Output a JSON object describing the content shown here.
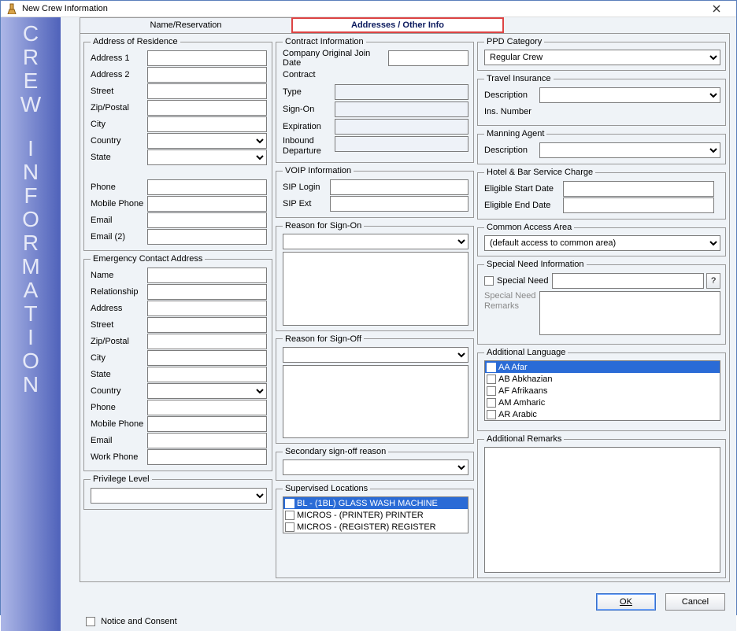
{
  "window": {
    "title": "New Crew Information"
  },
  "tabs": {
    "name_res": "Name/Reservation",
    "addresses": "Addresses / Other Info"
  },
  "sidebar": "CREW INFORMATION",
  "residence": {
    "legend": "Address of Residence",
    "address1": "Address 1",
    "address1_v": "",
    "address2": "Address 2",
    "address2_v": "",
    "street": "Street",
    "street_v": "",
    "zip": "Zip/Postal",
    "zip_v": "",
    "city": "City",
    "city_v": "",
    "country": "Country",
    "country_v": "",
    "state": "State",
    "state_v": "",
    "phone": "Phone",
    "phone_v": "",
    "mobile": "Mobile Phone",
    "mobile_v": "",
    "email": "Email",
    "email_v": "",
    "email2": "Email (2)",
    "email2_v": ""
  },
  "emergency": {
    "legend": "Emergency Contact Address",
    "name": "Name",
    "name_v": "",
    "relationship": "Relationship",
    "relationship_v": "",
    "address": "Address",
    "address_v": "",
    "street": "Street",
    "street_v": "",
    "zip": "Zip/Postal",
    "zip_v": "",
    "city": "City",
    "city_v": "",
    "state": "State",
    "state_v": "",
    "country": "Country",
    "country_v": "",
    "phone": "Phone",
    "phone_v": "",
    "mobile": "Mobile Phone",
    "mobile_v": "",
    "email": "Email",
    "email_v": "",
    "workphone": "Work Phone",
    "workphone_v": ""
  },
  "privilege": {
    "legend": "Privilege Level",
    "value": ""
  },
  "contract": {
    "legend": "Contract Information",
    "cojd": "Company Original Join Date",
    "cojd_v": "",
    "contract": "Contract",
    "type": "Type",
    "type_v": "",
    "signon": "Sign-On",
    "signon_v": "",
    "expiration": "Expiration",
    "expiration_v": "",
    "inbound": "Inbound Departure",
    "inbound_v": ""
  },
  "voip": {
    "legend": "VOIP Information",
    "login": "SIP Login",
    "login_v": "",
    "ext": "SIP Ext",
    "ext_v": ""
  },
  "signon_reason": {
    "legend": "Reason for Sign-On",
    "value": "",
    "text": ""
  },
  "signoff_reason": {
    "legend": "Reason for Sign-Off",
    "value": "",
    "text": ""
  },
  "signoff2": {
    "legend": "Secondary sign-off reason",
    "value": ""
  },
  "supervised": {
    "legend": "Supervised Locations",
    "items": [
      "BL - (1BL) GLASS WASH MACHINE",
      "MICROS - (PRINTER) PRINTER",
      "MICROS - (REGISTER) REGISTER"
    ]
  },
  "ppd": {
    "legend": "PPD  Category",
    "value": "Regular Crew"
  },
  "travel": {
    "legend": "Travel Insurance",
    "desc": "Description",
    "desc_v": "",
    "num": "Ins. Number",
    "num_v": ""
  },
  "manning": {
    "legend": "Manning Agent",
    "desc": "Description",
    "desc_v": ""
  },
  "hotel": {
    "legend": "Hotel & Bar Service Charge",
    "start": "Eligible Start Date",
    "start_v": "",
    "end": "Eligible End Date",
    "end_v": ""
  },
  "common": {
    "legend": "Common Access Area",
    "value": "(default access to common area)"
  },
  "special": {
    "legend": "Special Need Information",
    "cb": "Special Need",
    "qmark": "?",
    "remarks": "Special Need Remarks",
    "remarks_v": ""
  },
  "lang": {
    "legend": "Additional Language",
    "items": [
      "AA Afar",
      "AB Abkhazian",
      "AF Afrikaans",
      "AM Amharic",
      "AR Arabic"
    ]
  },
  "remarks": {
    "legend": "Additional Remarks",
    "text": ""
  },
  "buttons": {
    "ok": "OK",
    "cancel": "Cancel"
  },
  "notice": "Notice and Consent"
}
